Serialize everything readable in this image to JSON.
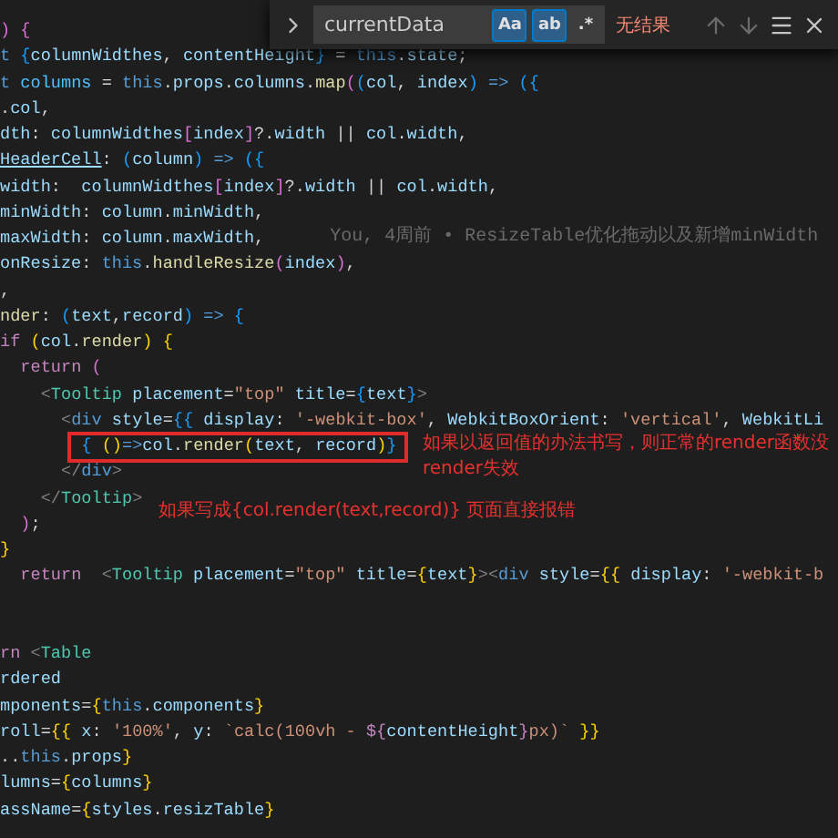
{
  "search": {
    "value": "currentData",
    "options": [
      {
        "label": "Aa",
        "selected": true
      },
      {
        "label": "ab",
        "selected": true
      },
      {
        "label": ".*",
        "selected": false
      }
    ],
    "status": "无结果"
  },
  "lines": [
    {
      "kind": "code",
      "highlighted": false,
      "segments": [
        {
          "kind": "m",
          "text": ") {"
        }
      ]
    },
    {
      "kind": "code",
      "highlighted": false,
      "segments": [
        {
          "kind": "k",
          "text": "t "
        },
        {
          "kind": "b",
          "text": "{"
        },
        {
          "kind": "v",
          "text": "columnWidthes"
        },
        {
          "kind": "p",
          "text": ", "
        },
        {
          "kind": "v",
          "text": "contentHeight"
        },
        {
          "kind": "b",
          "text": "}"
        },
        {
          "kind": "p",
          "text": " = "
        },
        {
          "kind": "k",
          "text": "this"
        },
        {
          "kind": "p",
          "text": "."
        },
        {
          "kind": "v",
          "text": "state"
        },
        {
          "kind": "p",
          "text": ";"
        }
      ]
    },
    {
      "kind": "code",
      "highlighted": false,
      "segments": [
        {
          "kind": "k",
          "text": "t "
        },
        {
          "kind": "C",
          "text": "columns"
        },
        {
          "kind": "p",
          "text": " = "
        },
        {
          "kind": "k",
          "text": "this"
        },
        {
          "kind": "p",
          "text": "."
        },
        {
          "kind": "v",
          "text": "props"
        },
        {
          "kind": "p",
          "text": "."
        },
        {
          "kind": "v",
          "text": "columns"
        },
        {
          "kind": "p",
          "text": "."
        },
        {
          "kind": "f",
          "text": "map"
        },
        {
          "kind": "m",
          "text": "("
        },
        {
          "kind": "b",
          "text": "("
        },
        {
          "kind": "v",
          "text": "col"
        },
        {
          "kind": "p",
          "text": ", "
        },
        {
          "kind": "v",
          "text": "index"
        },
        {
          "kind": "b",
          "text": ")"
        },
        {
          "kind": "k",
          "text": " => "
        },
        {
          "kind": "b",
          "text": "({"
        }
      ]
    },
    {
      "kind": "code",
      "highlighted": false,
      "segments": [
        {
          "kind": "p",
          "text": "."
        },
        {
          "kind": "v",
          "text": "col"
        },
        {
          "kind": "p",
          "text": ","
        }
      ]
    },
    {
      "kind": "code",
      "highlighted": false,
      "segments": [
        {
          "kind": "v",
          "text": "dth"
        },
        {
          "kind": "p",
          "text": ": "
        },
        {
          "kind": "v",
          "text": "columnWidthes"
        },
        {
          "kind": "m",
          "text": "["
        },
        {
          "kind": "v",
          "text": "index"
        },
        {
          "kind": "m",
          "text": "]"
        },
        {
          "kind": "p",
          "text": "?."
        },
        {
          "kind": "v",
          "text": "width"
        },
        {
          "kind": "p",
          "text": " || "
        },
        {
          "kind": "v",
          "text": "col"
        },
        {
          "kind": "p",
          "text": "."
        },
        {
          "kind": "v",
          "text": "width"
        },
        {
          "kind": "p",
          "text": ","
        }
      ]
    },
    {
      "kind": "code",
      "highlighted": false,
      "segments": [
        {
          "kind": "u",
          "text": "HeaderCell"
        },
        {
          "kind": "p",
          "text": ": "
        },
        {
          "kind": "b",
          "text": "("
        },
        {
          "kind": "v",
          "text": "column"
        },
        {
          "kind": "b",
          "text": ")"
        },
        {
          "kind": "k",
          "text": " => "
        },
        {
          "kind": "b",
          "text": "({"
        }
      ]
    },
    {
      "kind": "code",
      "highlighted": false,
      "segments": [
        {
          "kind": "v",
          "text": "width"
        },
        {
          "kind": "p",
          "text": ":  "
        },
        {
          "kind": "v",
          "text": "columnWidthes"
        },
        {
          "kind": "m",
          "text": "["
        },
        {
          "kind": "v",
          "text": "index"
        },
        {
          "kind": "m",
          "text": "]"
        },
        {
          "kind": "p",
          "text": "?."
        },
        {
          "kind": "v",
          "text": "width"
        },
        {
          "kind": "p",
          "text": " || "
        },
        {
          "kind": "v",
          "text": "col"
        },
        {
          "kind": "p",
          "text": "."
        },
        {
          "kind": "v",
          "text": "width"
        },
        {
          "kind": "p",
          "text": ","
        }
      ]
    },
    {
      "kind": "code",
      "highlighted": false,
      "segments": [
        {
          "kind": "v",
          "text": "minWidth"
        },
        {
          "kind": "p",
          "text": ": "
        },
        {
          "kind": "v",
          "text": "column"
        },
        {
          "kind": "p",
          "text": "."
        },
        {
          "kind": "v",
          "text": "minWidth"
        },
        {
          "kind": "p",
          "text": ","
        }
      ]
    },
    {
      "kind": "code",
      "highlighted": false,
      "segments": [
        {
          "kind": "v",
          "text": "maxWidth"
        },
        {
          "kind": "p",
          "text": ": "
        },
        {
          "kind": "v",
          "text": "column"
        },
        {
          "kind": "p",
          "text": "."
        },
        {
          "kind": "v",
          "text": "maxWidth"
        },
        {
          "kind": "p",
          "text": ","
        }
      ],
      "blame": "You, 4周前 • ResizeTable优化拖动以及新增minWidth"
    },
    {
      "kind": "code",
      "highlighted": false,
      "segments": [
        {
          "kind": "v",
          "text": "onResize"
        },
        {
          "kind": "p",
          "text": ": "
        },
        {
          "kind": "k",
          "text": "this"
        },
        {
          "kind": "p",
          "text": "."
        },
        {
          "kind": "f",
          "text": "handleResize"
        },
        {
          "kind": "m",
          "text": "("
        },
        {
          "kind": "v",
          "text": "index"
        },
        {
          "kind": "m",
          "text": ")"
        },
        {
          "kind": "p",
          "text": ","
        }
      ]
    },
    {
      "kind": "code",
      "highlighted": false,
      "segments": [
        {
          "kind": "p",
          "text": ","
        }
      ]
    },
    {
      "kind": "code",
      "highlighted": false,
      "segments": [
        {
          "kind": "f",
          "text": "nder"
        },
        {
          "kind": "p",
          "text": ": "
        },
        {
          "kind": "b",
          "text": "("
        },
        {
          "kind": "v",
          "text": "text"
        },
        {
          "kind": "p",
          "text": ","
        },
        {
          "kind": "v",
          "text": "record"
        },
        {
          "kind": "b",
          "text": ")"
        },
        {
          "kind": "k",
          "text": " => "
        },
        {
          "kind": "b",
          "text": "{"
        }
      ]
    },
    {
      "kind": "code",
      "highlighted": false,
      "segments": [
        {
          "kind": "c",
          "text": "if "
        },
        {
          "kind": "y",
          "text": "("
        },
        {
          "kind": "v",
          "text": "col"
        },
        {
          "kind": "p",
          "text": "."
        },
        {
          "kind": "f",
          "text": "render"
        },
        {
          "kind": "y",
          "text": ") {"
        }
      ]
    },
    {
      "kind": "code",
      "highlighted": false,
      "segments": [
        {
          "kind": "c",
          "text": "  return "
        },
        {
          "kind": "m",
          "text": "("
        }
      ]
    },
    {
      "kind": "code",
      "highlighted": false,
      "segments": [
        {
          "kind": "g",
          "text": "    <"
        },
        {
          "kind": "t",
          "text": "Tooltip "
        },
        {
          "kind": "v",
          "text": "placement"
        },
        {
          "kind": "p",
          "text": "="
        },
        {
          "kind": "s",
          "text": "\"top\" "
        },
        {
          "kind": "v",
          "text": "title"
        },
        {
          "kind": "p",
          "text": "="
        },
        {
          "kind": "b",
          "text": "{"
        },
        {
          "kind": "v",
          "text": "text"
        },
        {
          "kind": "b",
          "text": "}"
        },
        {
          "kind": "g",
          "text": ">"
        }
      ]
    },
    {
      "kind": "code",
      "highlighted": false,
      "segments": [
        {
          "kind": "g",
          "text": "      <"
        },
        {
          "kind": "k",
          "text": "div "
        },
        {
          "kind": "v",
          "text": "style"
        },
        {
          "kind": "p",
          "text": "="
        },
        {
          "kind": "b",
          "text": "{{ "
        },
        {
          "kind": "v",
          "text": "display"
        },
        {
          "kind": "p",
          "text": ": "
        },
        {
          "kind": "s",
          "text": "'-webkit-box'"
        },
        {
          "kind": "p",
          "text": ", "
        },
        {
          "kind": "v",
          "text": "WebkitBoxOrient"
        },
        {
          "kind": "p",
          "text": ": "
        },
        {
          "kind": "s",
          "text": "'vertical'"
        },
        {
          "kind": "p",
          "text": ", "
        },
        {
          "kind": "v",
          "text": "WebkitLi"
        }
      ]
    },
    {
      "kind": "code",
      "highlighted": true,
      "segments": [
        {
          "kind": "b",
          "text": "        { "
        },
        {
          "kind": "y",
          "text": "()"
        },
        {
          "kind": "k",
          "text": "=>"
        },
        {
          "kind": "v",
          "text": "col"
        },
        {
          "kind": "p",
          "text": "."
        },
        {
          "kind": "f",
          "text": "render"
        },
        {
          "kind": "y",
          "text": "("
        },
        {
          "kind": "v",
          "text": "text"
        },
        {
          "kind": "p",
          "text": ", "
        },
        {
          "kind": "v",
          "text": "record"
        },
        {
          "kind": "y",
          "text": ")"
        },
        {
          "kind": "b",
          "text": "}"
        }
      ]
    },
    {
      "kind": "code",
      "highlighted": false,
      "segments": [
        {
          "kind": "g",
          "text": "      </"
        },
        {
          "kind": "k",
          "text": "div"
        },
        {
          "kind": "g",
          "text": ">"
        }
      ]
    },
    {
      "kind": "code",
      "highlighted": false,
      "segments": [
        {
          "kind": "g",
          "text": "    </"
        },
        {
          "kind": "t",
          "text": "Tooltip"
        },
        {
          "kind": "g",
          "text": ">"
        }
      ]
    },
    {
      "kind": "code",
      "highlighted": false,
      "segments": [
        {
          "kind": "m",
          "text": "  )"
        },
        {
          "kind": "p",
          "text": ";"
        }
      ]
    },
    {
      "kind": "code",
      "highlighted": false,
      "segments": [
        {
          "kind": "y",
          "text": "}"
        }
      ]
    },
    {
      "kind": "code",
      "highlighted": false,
      "segments": [
        {
          "kind": "c",
          "text": "  return  "
        },
        {
          "kind": "g",
          "text": "<"
        },
        {
          "kind": "t",
          "text": "Tooltip "
        },
        {
          "kind": "v",
          "text": "placement"
        },
        {
          "kind": "p",
          "text": "="
        },
        {
          "kind": "s",
          "text": "\"top\" "
        },
        {
          "kind": "v",
          "text": "title"
        },
        {
          "kind": "p",
          "text": "="
        },
        {
          "kind": "y",
          "text": "{"
        },
        {
          "kind": "v",
          "text": "text"
        },
        {
          "kind": "y",
          "text": "}"
        },
        {
          "kind": "g",
          "text": "><"
        },
        {
          "kind": "k",
          "text": "div "
        },
        {
          "kind": "v",
          "text": "style"
        },
        {
          "kind": "p",
          "text": "="
        },
        {
          "kind": "y",
          "text": "{{ "
        },
        {
          "kind": "v",
          "text": "display"
        },
        {
          "kind": "p",
          "text": ": "
        },
        {
          "kind": "s",
          "text": "'-webkit-b"
        }
      ]
    },
    {
      "kind": "blank"
    },
    {
      "kind": "blank"
    },
    {
      "kind": "code",
      "highlighted": false,
      "segments": [
        {
          "kind": "c",
          "text": "rn "
        },
        {
          "kind": "g",
          "text": "<"
        },
        {
          "kind": "t",
          "text": "Table"
        }
      ]
    },
    {
      "kind": "code",
      "highlighted": false,
      "segments": [
        {
          "kind": "v",
          "text": "rdered"
        }
      ]
    },
    {
      "kind": "code",
      "highlighted": false,
      "segments": [
        {
          "kind": "v",
          "text": "mponents"
        },
        {
          "kind": "p",
          "text": "="
        },
        {
          "kind": "y",
          "text": "{"
        },
        {
          "kind": "k",
          "text": "this"
        },
        {
          "kind": "p",
          "text": "."
        },
        {
          "kind": "v",
          "text": "components"
        },
        {
          "kind": "y",
          "text": "}"
        }
      ]
    },
    {
      "kind": "code",
      "highlighted": false,
      "segments": [
        {
          "kind": "v",
          "text": "roll"
        },
        {
          "kind": "p",
          "text": "="
        },
        {
          "kind": "y",
          "text": "{{ "
        },
        {
          "kind": "v",
          "text": "x"
        },
        {
          "kind": "p",
          "text": ": "
        },
        {
          "kind": "s",
          "text": "'100%'"
        },
        {
          "kind": "p",
          "text": ", "
        },
        {
          "kind": "v",
          "text": "y"
        },
        {
          "kind": "p",
          "text": ": "
        },
        {
          "kind": "s",
          "text": "`calc(100vh - "
        },
        {
          "kind": "c",
          "text": "${"
        },
        {
          "kind": "v",
          "text": "contentHeight"
        },
        {
          "kind": "c",
          "text": "}"
        },
        {
          "kind": "s",
          "text": "px)`"
        },
        {
          "kind": "y",
          "text": " }}"
        }
      ]
    },
    {
      "kind": "code",
      "highlighted": false,
      "segments": [
        {
          "kind": "p",
          "text": ".."
        },
        {
          "kind": "k",
          "text": "this"
        },
        {
          "kind": "p",
          "text": "."
        },
        {
          "kind": "v",
          "text": "props"
        },
        {
          "kind": "y",
          "text": "}"
        }
      ]
    },
    {
      "kind": "code",
      "highlighted": false,
      "segments": [
        {
          "kind": "v",
          "text": "lumns"
        },
        {
          "kind": "p",
          "text": "="
        },
        {
          "kind": "y",
          "text": "{"
        },
        {
          "kind": "v",
          "text": "columns"
        },
        {
          "kind": "y",
          "text": "}"
        }
      ]
    },
    {
      "kind": "code",
      "highlighted": false,
      "segments": [
        {
          "kind": "v",
          "text": "assName"
        },
        {
          "kind": "p",
          "text": "="
        },
        {
          "kind": "y",
          "text": "{"
        },
        {
          "kind": "v",
          "text": "styles"
        },
        {
          "kind": "p",
          "text": "."
        },
        {
          "kind": "v",
          "text": "resizTable"
        },
        {
          "kind": "y",
          "text": "}"
        }
      ]
    }
  ],
  "notes": [
    {
      "lines": [
        "如果以返回值的办法书写，则正常的render函数没",
        "render失效"
      ]
    },
    {
      "lines": [
        "如果写成{col.render(text,record)} 页面直接报错"
      ]
    }
  ]
}
